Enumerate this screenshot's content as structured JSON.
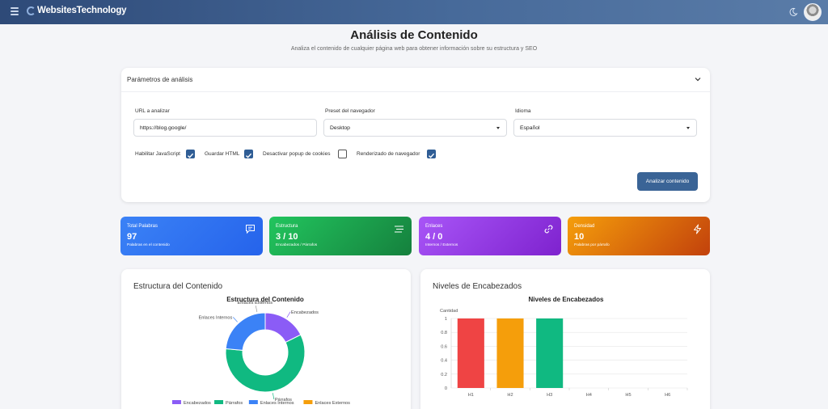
{
  "app": {
    "brand": "WebsitesTechnology"
  },
  "header": {
    "title": "Análisis de Contenido",
    "subtitle": "Analiza el contenido de cualquier página web para obtener información sobre su estructura y SEO"
  },
  "params": {
    "title": "Parámetros de análisis",
    "url_label": "URL a analizar",
    "url_value": "https://blog.google/",
    "preset_label": "Preset del navegador",
    "preset_value": "Desktop",
    "lang_label": "Idioma",
    "lang_value": "Español",
    "checks": [
      {
        "label": "Habilitar JavaScript",
        "checked": true
      },
      {
        "label": "Guardar HTML",
        "checked": true
      },
      {
        "label": "Desactivar popup de cookies",
        "checked": false
      },
      {
        "label": "Renderizado de navegador",
        "checked": true
      }
    ],
    "analyze_label": "Analizar contenido"
  },
  "stats": [
    {
      "title": "Total Palabras",
      "value": "97",
      "desc": "Palabras en el contenido",
      "color_from": "#3b82f6",
      "color_to": "#2563eb",
      "icon": "message-icon"
    },
    {
      "title": "Estructura",
      "value": "3 / 10",
      "desc": "Encabezados / Párrafos",
      "color_from": "#22c55e",
      "color_to": "#15803d",
      "icon": "align-icon"
    },
    {
      "title": "Enlaces",
      "value": "4 / 0",
      "desc": "Internos / Externos",
      "color_from": "#a855f7",
      "color_to": "#7e22ce",
      "icon": "link-icon"
    },
    {
      "title": "Densidad",
      "value": "10",
      "desc": "Palabras por párrafo",
      "color_from": "#f59e0b",
      "color_to": "#c2410c",
      "icon": "bolt-icon"
    }
  ],
  "panels": {
    "structure_title": "Estructura del Contenido",
    "headings_title": "Niveles de Encabezados"
  },
  "chart_data": [
    {
      "type": "pie",
      "title": "Estructura del Contenido",
      "categories": [
        "Encabezados",
        "Párrafos",
        "Enlaces Internos",
        "Enlaces Externos"
      ],
      "values": [
        3,
        10,
        4,
        0
      ],
      "colors": [
        "#8b5cf6",
        "#10b981",
        "#3b82f6",
        "#f59e0b"
      ],
      "legend": "bottom"
    },
    {
      "type": "bar",
      "title": "Niveles de Encabezados",
      "categories": [
        "H1",
        "H2",
        "H3",
        "H4",
        "H5",
        "H6"
      ],
      "values": [
        1,
        1,
        1,
        0,
        0,
        0
      ],
      "colors": [
        "#ef4444",
        "#f59e0b",
        "#10b981",
        "#3b82f6",
        "#8b5cf6",
        "#ec4899"
      ],
      "ylabel": "Cantidad",
      "ylim": [
        0,
        1
      ],
      "yticks": [
        "0",
        "0.2",
        "0.4",
        "0.6",
        "0.8",
        "1"
      ],
      "grid": true
    }
  ]
}
